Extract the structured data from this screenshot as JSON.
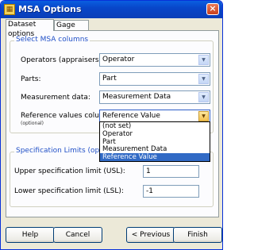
{
  "window": {
    "title": "MSA Options",
    "icon": "gage-icon",
    "close_label": "×"
  },
  "tabs": [
    {
      "label": "Dataset options"
    },
    {
      "label": "Gage Info"
    }
  ],
  "columns_group": {
    "title": "Select MSA columns",
    "operators": {
      "label": "Operators (appraisers):",
      "value": "Operator"
    },
    "parts": {
      "label": "Parts:",
      "value": "Part"
    },
    "measurement": {
      "label": "Measurement data:",
      "value": "Measurement Data"
    },
    "reference": {
      "label": "Reference values column:",
      "sublabel": "(optional)",
      "value": "Reference Value"
    },
    "dropdown_options": [
      "(not set)",
      "Operator",
      "Part",
      "Measurement Data",
      "Reference Value"
    ],
    "dropdown_selected_index": 4
  },
  "spec_group": {
    "title": "Specification Limits (optional)",
    "usl": {
      "label": "Upper specification limit (USL):",
      "value": "1"
    },
    "lsl": {
      "label": "Lower specification limit (LSL):",
      "value": "-1"
    }
  },
  "buttons": {
    "help": "Help",
    "cancel": "Cancel",
    "previous": "< Previous",
    "finish": "Finish"
  },
  "icons": {
    "dropdown_arrow": "chevron-down-icon"
  },
  "colors": {
    "titlebar": "#0846c9",
    "group_title": "#2150c7",
    "selection": "#316ac5"
  }
}
